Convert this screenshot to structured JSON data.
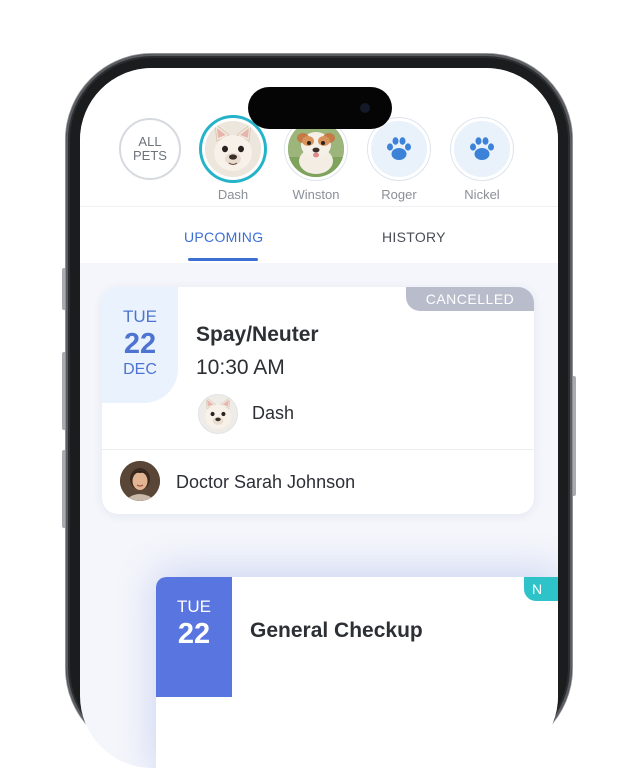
{
  "pets": {
    "all_label": "ALL\nPETS",
    "items": [
      {
        "name": "Dash",
        "selected": true,
        "avatar": "french-bulldog-photo"
      },
      {
        "name": "Winston",
        "selected": false,
        "avatar": "bulldog-puppy-photo"
      },
      {
        "name": "Roger",
        "selected": false,
        "avatar": "paw-icon"
      },
      {
        "name": "Nickel",
        "selected": false,
        "avatar": "paw-icon"
      }
    ]
  },
  "tabs": [
    {
      "label": "UPCOMING",
      "active": true
    },
    {
      "label": "HISTORY",
      "active": false
    }
  ],
  "appointments": [
    {
      "status": "CANCELLED",
      "date": {
        "dow": "TUE",
        "day": "22",
        "month": "DEC"
      },
      "title": "Spay/Neuter",
      "time": "10:30 AM",
      "pet": "Dash",
      "doctor": "Doctor Sarah Johnson"
    },
    {
      "status": "N",
      "date": {
        "dow": "TUE",
        "day": "22"
      },
      "title": "General Checkup"
    }
  ],
  "colors": {
    "accent": "#3c6fd3",
    "selected_ring": "#24b3c8",
    "cancelled_badge": "#b8bccb",
    "date_box_light": "#eaf2fd",
    "date_box_strong": "#5875e0",
    "new_badge": "#2ec3c9"
  }
}
